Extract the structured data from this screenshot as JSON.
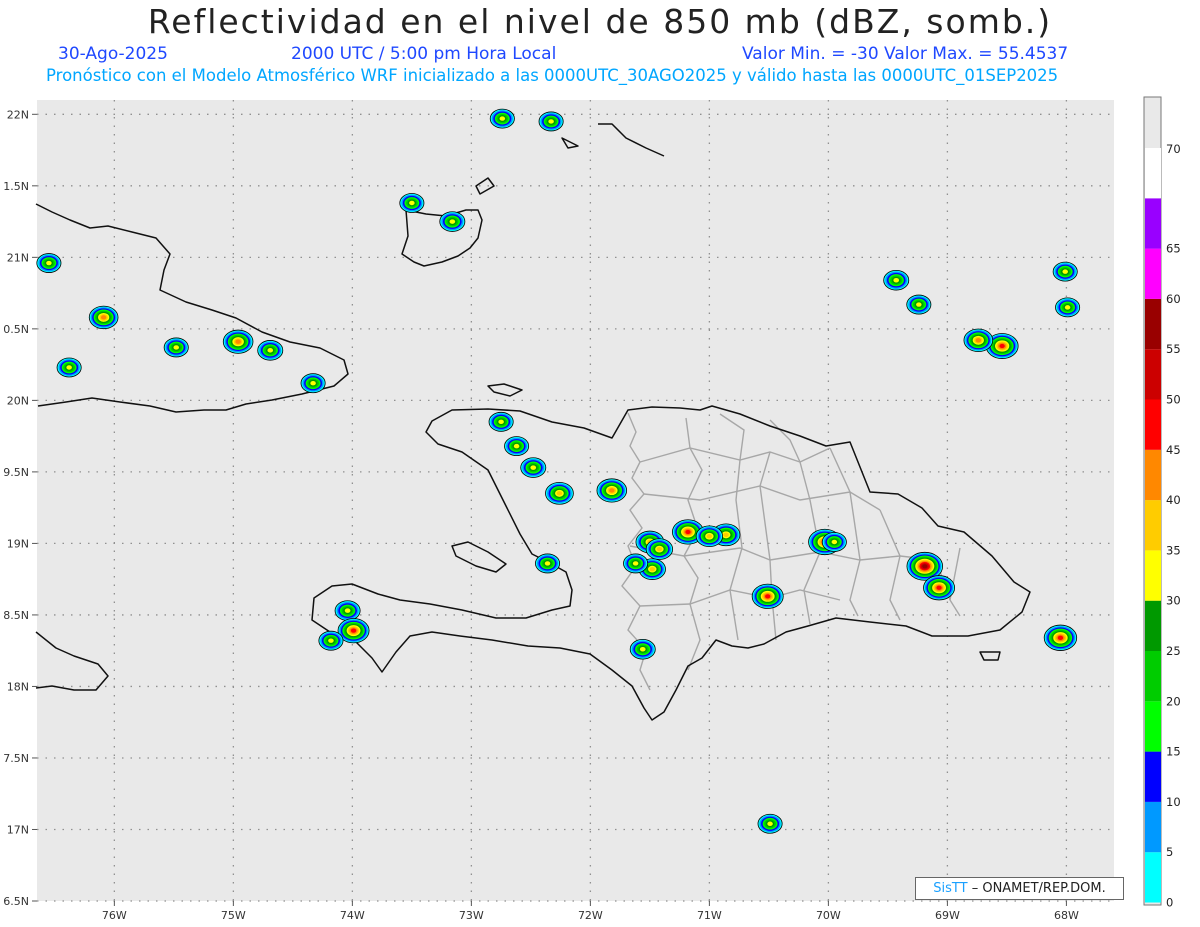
{
  "title": "Reflectividad en el nivel de 850 mb (dBZ, somb.)",
  "subtitle": {
    "date": "30-Ago-2025",
    "time": "2000 UTC / 5:00 pm Hora Local",
    "minmax": "Valor Min. = -30  Valor Max. = 55.4537",
    "forecast": "Pronóstico con el Modelo Atmosférico WRF inicializado a las 0000UTC_30AGO2025 y válido hasta las  0000UTC_01SEP2025"
  },
  "credit": {
    "sis": "SisTT",
    "rest": "– ONAMET/REP.DOM."
  },
  "colors": {
    "map_bg": "#e9e9e9",
    "coast": "#111111",
    "provinces": "#a7a7a7",
    "grid_dots": "#909090"
  },
  "chart_data": {
    "type": "heatmap",
    "title": "Reflectividad en el nivel de 850 mb (dBZ, somb.)",
    "xlim": [
      -76.65,
      -67.6
    ],
    "ylim": [
      16.5,
      22.1
    ],
    "xticks": [
      -76,
      -75,
      -74,
      -73,
      -72,
      -71,
      -70,
      -69,
      -68
    ],
    "xtick_labels": [
      "76W",
      "75W",
      "74W",
      "73W",
      "72W",
      "71W",
      "70W",
      "69W",
      "68W"
    ],
    "yticks": [
      16.5,
      17,
      17.5,
      18,
      18.5,
      19,
      19.5,
      20,
      20.5,
      21,
      21.5,
      22
    ],
    "ytick_labels": [
      "6.5N",
      "17N",
      "7.5N",
      "18N",
      "8.5N",
      "19N",
      "9.5N",
      "20N",
      "0.5N",
      "21N",
      "1.5N",
      "22N"
    ],
    "grid": true,
    "value_min": -30,
    "value_max": 55.4537,
    "colorbar": {
      "levels": [
        0,
        5,
        10,
        15,
        20,
        25,
        30,
        35,
        40,
        45,
        50,
        55,
        60,
        65,
        70
      ],
      "colors": [
        "#00ffff",
        "#0099ff",
        "#0000ff",
        "#00ff00",
        "#00cc00",
        "#009900",
        "#ffff00",
        "#ffcc00",
        "#ff8800",
        "#ff0000",
        "#cc0000",
        "#990000",
        "#ff00ff",
        "#9900ff",
        "#ffffff"
      ]
    },
    "cells": [
      {
        "lon": -69.19,
        "lat": 18.84,
        "dbz": 55
      },
      {
        "lon": -69.07,
        "lat": 18.69,
        "dbz": 45
      },
      {
        "lon": -68.54,
        "lat": 20.38,
        "dbz": 47
      },
      {
        "lon": -68.74,
        "lat": 20.42,
        "dbz": 40
      },
      {
        "lon": -68.05,
        "lat": 18.34,
        "dbz": 48
      },
      {
        "lon": -70.03,
        "lat": 19.01,
        "dbz": 48
      },
      {
        "lon": -70.51,
        "lat": 18.63,
        "dbz": 45
      },
      {
        "lon": -71.82,
        "lat": 19.37,
        "dbz": 42
      },
      {
        "lon": -71.18,
        "lat": 19.08,
        "dbz": 45
      },
      {
        "lon": -70.86,
        "lat": 19.06,
        "dbz": 38
      },
      {
        "lon": -71.0,
        "lat": 19.05,
        "dbz": 35
      },
      {
        "lon": -71.48,
        "lat": 18.82,
        "dbz": 35
      },
      {
        "lon": -71.5,
        "lat": 19.01,
        "dbz": 38
      },
      {
        "lon": -71.42,
        "lat": 18.96,
        "dbz": 35
      },
      {
        "lon": -72.26,
        "lat": 19.35,
        "dbz": 38
      },
      {
        "lon": -72.48,
        "lat": 19.53,
        "dbz": 32
      },
      {
        "lon": -72.62,
        "lat": 19.68,
        "dbz": 30
      },
      {
        "lon": -72.36,
        "lat": 18.86,
        "dbz": 30
      },
      {
        "lon": -72.75,
        "lat": 19.85,
        "dbz": 30
      },
      {
        "lon": -76.09,
        "lat": 20.58,
        "dbz": 40
      },
      {
        "lon": -74.96,
        "lat": 20.41,
        "dbz": 42
      },
      {
        "lon": -74.69,
        "lat": 20.35,
        "dbz": 32
      },
      {
        "lon": -74.33,
        "lat": 20.12,
        "dbz": 30
      },
      {
        "lon": -75.48,
        "lat": 20.37,
        "dbz": 30
      },
      {
        "lon": -76.55,
        "lat": 20.96,
        "dbz": 30
      },
      {
        "lon": -76.38,
        "lat": 20.23,
        "dbz": 30
      },
      {
        "lon": -73.16,
        "lat": 21.25,
        "dbz": 32
      },
      {
        "lon": -73.5,
        "lat": 21.38,
        "dbz": 30
      },
      {
        "lon": -72.33,
        "lat": 21.95,
        "dbz": 30
      },
      {
        "lon": -72.74,
        "lat": 21.97,
        "dbz": 30
      },
      {
        "lon": -74.04,
        "lat": 18.53,
        "dbz": 32
      },
      {
        "lon": -73.99,
        "lat": 18.39,
        "dbz": 45
      },
      {
        "lon": -74.18,
        "lat": 18.32,
        "dbz": 30
      },
      {
        "lon": -71.56,
        "lat": 18.26,
        "dbz": 32
      },
      {
        "lon": -70.49,
        "lat": 17.04,
        "dbz": 30
      },
      {
        "lon": -69.43,
        "lat": 20.84,
        "dbz": 32
      },
      {
        "lon": -69.24,
        "lat": 20.67,
        "dbz": 30
      },
      {
        "lon": -67.99,
        "lat": 20.65,
        "dbz": 30
      },
      {
        "lon": -68.01,
        "lat": 20.9,
        "dbz": 30
      },
      {
        "lon": -69.95,
        "lat": 19.01,
        "dbz": 30
      },
      {
        "lon": -71.62,
        "lat": 18.86,
        "dbz": 30
      }
    ]
  }
}
